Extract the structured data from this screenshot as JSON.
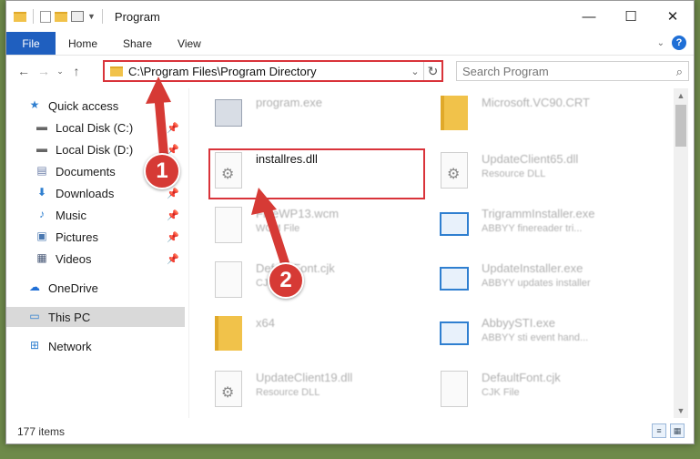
{
  "window": {
    "title": "Program",
    "controls": {
      "minimize": "—",
      "maximize": "☐",
      "close": "✕"
    }
  },
  "ribbon": {
    "tabs": [
      {
        "label": "File"
      },
      {
        "label": "Home"
      },
      {
        "label": "Share"
      },
      {
        "label": "View"
      }
    ],
    "help_icon": "?"
  },
  "navigation": {
    "address": "C:\\Program Files\\Program Directory",
    "search_placeholder": "Search Program"
  },
  "sidebar": {
    "items": [
      {
        "label": "Quick access",
        "icon": "star-icon",
        "pinned": false
      },
      {
        "label": "Local Disk (C:)",
        "icon": "drive-icon",
        "pinned": true
      },
      {
        "label": "Local Disk (D:)",
        "icon": "drive-icon",
        "pinned": true
      },
      {
        "label": "Documents",
        "icon": "documents-icon",
        "pinned": true
      },
      {
        "label": "Downloads",
        "icon": "download-icon",
        "pinned": true
      },
      {
        "label": "Music",
        "icon": "music-icon",
        "pinned": true
      },
      {
        "label": "Pictures",
        "icon": "pictures-icon",
        "pinned": true
      },
      {
        "label": "Videos",
        "icon": "videos-icon",
        "pinned": true
      },
      {
        "label": "OneDrive",
        "icon": "cloud-icon",
        "pinned": false
      },
      {
        "label": "This PC",
        "icon": "computer-icon",
        "pinned": false,
        "selected": true
      },
      {
        "label": "Network",
        "icon": "network-icon",
        "pinned": false
      }
    ]
  },
  "files": {
    "left": [
      {
        "name": "program.exe",
        "desc": "",
        "icon": "exe-icon"
      },
      {
        "name": "installres.dll",
        "desc": "",
        "icon": "dll-icon"
      },
      {
        "name": "FineWP13.wcm",
        "desc": "WCM File",
        "icon": "file-icon"
      },
      {
        "name": "DefaultFont.cjk",
        "desc": "CJK File",
        "icon": "file-icon"
      },
      {
        "name": "x64",
        "desc": "",
        "icon": "folder-icon"
      },
      {
        "name": "UpdateClient19.dll",
        "desc": "Resource DLL",
        "icon": "dll-icon"
      }
    ],
    "right": [
      {
        "name": "Microsoft.VC90.CRT",
        "desc": "",
        "icon": "folder-icon"
      },
      {
        "name": "UpdateClient65.dll",
        "desc": "Resource DLL",
        "icon": "dll-icon"
      },
      {
        "name": "TrigrammInstaller.exe",
        "desc": "ABBYY finereader tri...",
        "icon": "app-icon"
      },
      {
        "name": "UpdateInstaller.exe",
        "desc": "ABBYY updates installer",
        "icon": "app-icon"
      },
      {
        "name": "AbbyySTI.exe",
        "desc": "ABBYY sti event hand...",
        "icon": "app-icon"
      },
      {
        "name": "DefaultFont.cjk",
        "desc": "CJK File",
        "icon": "file-icon"
      }
    ]
  },
  "status": {
    "count": "177 items"
  },
  "annotations": {
    "step1": "1",
    "step2": "2"
  },
  "colors": {
    "accent": "#1f5fbf",
    "highlight": "#d9333a"
  }
}
